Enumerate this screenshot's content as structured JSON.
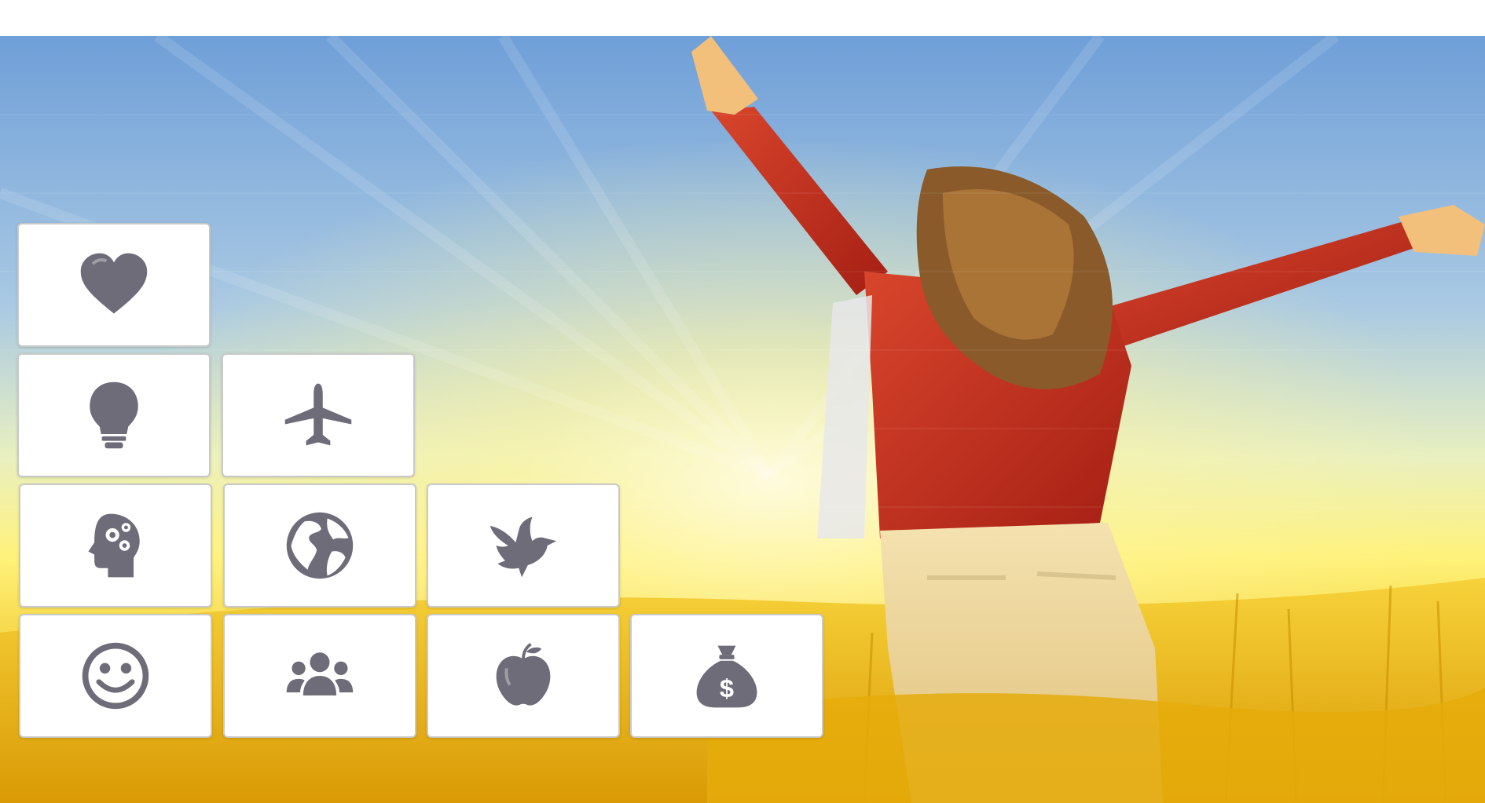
{
  "icons": [
    "heart-icon",
    "lightbulb-icon",
    "airplane-icon",
    "head-gears-icon",
    "globe-icon",
    "dove-icon",
    "smiley-face-icon",
    "people-group-icon",
    "apple-icon",
    "money-bag-icon"
  ],
  "colors": {
    "icon": "#6d6c78",
    "tile_bg": "#ffffff",
    "tile_border": "#c9c9c9",
    "sky_top": "#6f9fd8",
    "sun_glow": "#fff7b0",
    "field": "#e8b800",
    "shirt": "#c0301f"
  },
  "money_symbol": "$"
}
